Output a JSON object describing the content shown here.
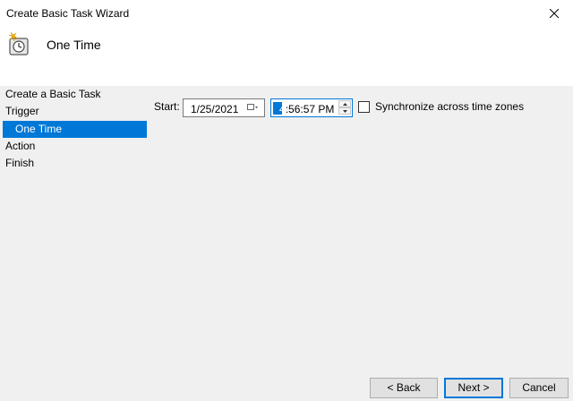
{
  "window": {
    "title": "Create Basic Task Wizard"
  },
  "header": {
    "title": "One Time",
    "icon": "clock-icon"
  },
  "steps": [
    {
      "label": "Create a Basic Task",
      "active": false
    },
    {
      "label": "Trigger",
      "active": false
    },
    {
      "label": "One Time",
      "active": true
    },
    {
      "label": "Action",
      "active": false
    },
    {
      "label": "Finish",
      "active": false
    }
  ],
  "form": {
    "start_label": "Start:",
    "date_value": "1/25/2021",
    "time_hour": "4",
    "time_rest": ":56:57 PM",
    "sync_label": "Synchronize across time zones",
    "sync_checked": false
  },
  "buttons": {
    "back": "< Back",
    "next": "Next >",
    "cancel": "Cancel"
  },
  "colors": {
    "accent": "#0078d7",
    "background": "#f0f0f0"
  }
}
